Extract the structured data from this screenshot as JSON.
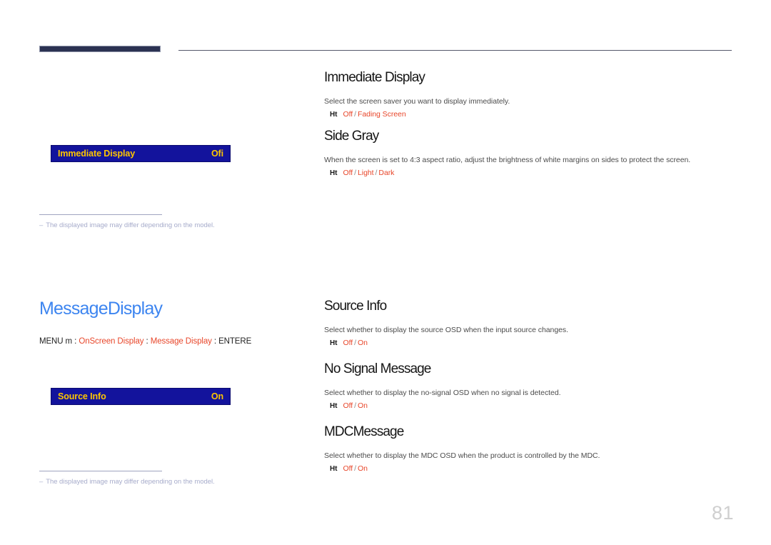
{
  "header": {
    "accent_bar_color": "#2b3252",
    "rule_color": "#55586b"
  },
  "page_number": "81",
  "colors": {
    "osd_background": "#13139c",
    "osd_text": "#ffc600",
    "section_title": "#3d85f0",
    "option_red": "#e8462a",
    "note_text": "#a7accb"
  },
  "left": {
    "osd_immediate": {
      "label": "Immediate Display",
      "value": "Ofi"
    },
    "osd_source": {
      "label": "Source Info",
      "value": "On"
    },
    "notes": [
      {
        "dash": "–",
        "text": "The displayed image may differ depending on the model."
      },
      {
        "dash": "–",
        "text": "The displayed image may differ depending on the model."
      }
    ],
    "section": {
      "title": "MessageDisplay",
      "breadcrumb": {
        "prefix": "MENU m",
        "sep1": " : ",
        "item1": "OnScreen Display",
        "sep2": " : ",
        "item2": "Message Display",
        "sep3": " : ",
        "suffix": "ENTERE"
      }
    }
  },
  "right": {
    "topics": [
      {
        "heading": "Immediate Display",
        "description": "Select the screen saver you want to display immediately.",
        "marker": "Ht",
        "options": [
          "Off",
          "Fading Screen"
        ]
      },
      {
        "heading": "Side Gray",
        "description": "When the screen is set to 4:3 aspect ratio, adjust the brightness of white margins on sides to protect the screen.",
        "marker": "Ht",
        "options": [
          "Off",
          "Light",
          "Dark"
        ]
      },
      {
        "heading": "Source Info",
        "description": "Select whether to display the source OSD when the input source changes.",
        "marker": "Ht",
        "options": [
          "Off",
          "On"
        ]
      },
      {
        "heading": "No Signal Message",
        "description": "Select whether to display the no-signal OSD when no signal is detected.",
        "marker": "Ht",
        "options": [
          "Off",
          "On"
        ]
      },
      {
        "heading": "MDCMessage",
        "description": "Select whether to display the MDC OSD when the product is controlled by the MDC.",
        "marker": "Ht",
        "options": [
          "Off",
          "On"
        ]
      }
    ]
  }
}
